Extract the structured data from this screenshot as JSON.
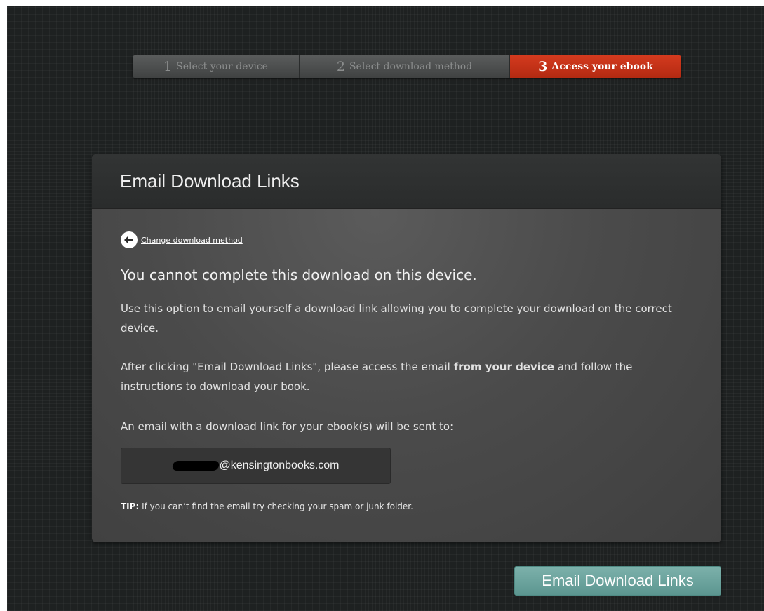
{
  "steps": [
    {
      "num": "1",
      "label": "Select your device",
      "active": false
    },
    {
      "num": "2",
      "label": "Select download method",
      "active": false
    },
    {
      "num": "3",
      "label": "Access your ebook",
      "active": true
    }
  ],
  "panel": {
    "title": "Email Download Links",
    "back_link": "Change download method",
    "headline": "You cannot complete this download on this device.",
    "para1": "Use this option to email yourself a download link allowing you to complete your download on the correct device.",
    "para2_before": "After clicking \"Email Download Links\", please access the email ",
    "para2_bold": "from your device",
    "para2_after": " and follow the instructions to download your book.",
    "para3": "An email with a download link for your ebook(s) will be sent to:",
    "email_domain": "@kensingtonbooks.com",
    "tip_label": "TIP:",
    "tip_text": " If you can’t find the email try checking your spam or junk folder."
  },
  "submit_label": "Email Download Links",
  "colors": {
    "background": "#1e2121",
    "active_step": "#c5311a",
    "button": "#6ba39d"
  },
  "icons": {
    "back": "arrow-left-circle-icon"
  }
}
